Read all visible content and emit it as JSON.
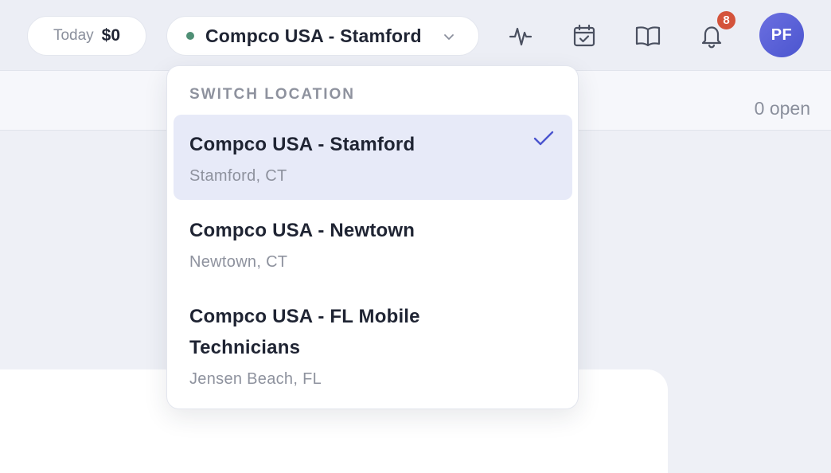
{
  "header": {
    "today_label": "Today",
    "today_value": "$0",
    "current_location": "Compco USA - Stamford",
    "notification_count": "8",
    "avatar_initials": "PF",
    "icons": [
      "activity-icon",
      "calendar-check-icon",
      "book-open-icon",
      "bell-icon"
    ]
  },
  "subheader": {
    "open_count": "0 open"
  },
  "location_menu": {
    "heading": "SWITCH LOCATION",
    "items": [
      {
        "name": "Compco USA - Stamford",
        "city": "Stamford, CT",
        "selected": true
      },
      {
        "name": "Compco USA - Newtown",
        "city": "Newtown, CT",
        "selected": false
      },
      {
        "name": "Compco USA - FL Mobile Technicians",
        "city": "Jensen Beach, FL",
        "selected": false
      }
    ]
  },
  "colors": {
    "accent": "#4b55cf",
    "status_dot": "#4f8f75",
    "badge": "#d4533b",
    "selected_row": "#e7eaf8"
  }
}
